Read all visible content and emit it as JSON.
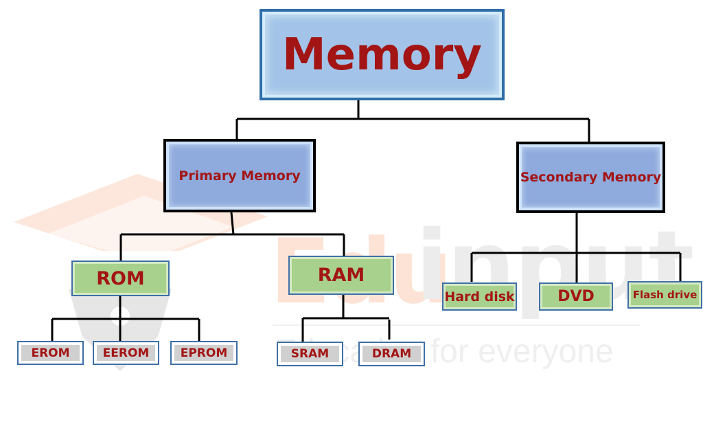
{
  "diagram": {
    "title": "Memory",
    "root": {
      "label": "Memory",
      "children": [
        {
          "label": "Primary Memory",
          "children": [
            {
              "label": "ROM",
              "children": [
                {
                  "label": "EROM"
                },
                {
                  "label": "EEROM"
                },
                {
                  "label": "EPROM"
                }
              ]
            },
            {
              "label": "RAM",
              "children": [
                {
                  "label": "SRAM"
                },
                {
                  "label": "DRAM"
                }
              ]
            }
          ]
        },
        {
          "label": "Secondary Memory",
          "children": [
            {
              "label": "Hard disk"
            },
            {
              "label": "DVD"
            },
            {
              "label": "Flash drive"
            }
          ]
        }
      ]
    }
  },
  "watermark": {
    "brand_part1": "Edu",
    "brand_part2": "input",
    "tagline": "Education for everyone"
  },
  "colors": {
    "text": "#a31515",
    "root_fill": "#a3c4e8",
    "level1_fill": "#8faadc",
    "level2_fill": "#a9d18e",
    "leaf_fill": "#d0d0d0",
    "border_blue": "#2f6ea8",
    "connector": "#000000"
  }
}
